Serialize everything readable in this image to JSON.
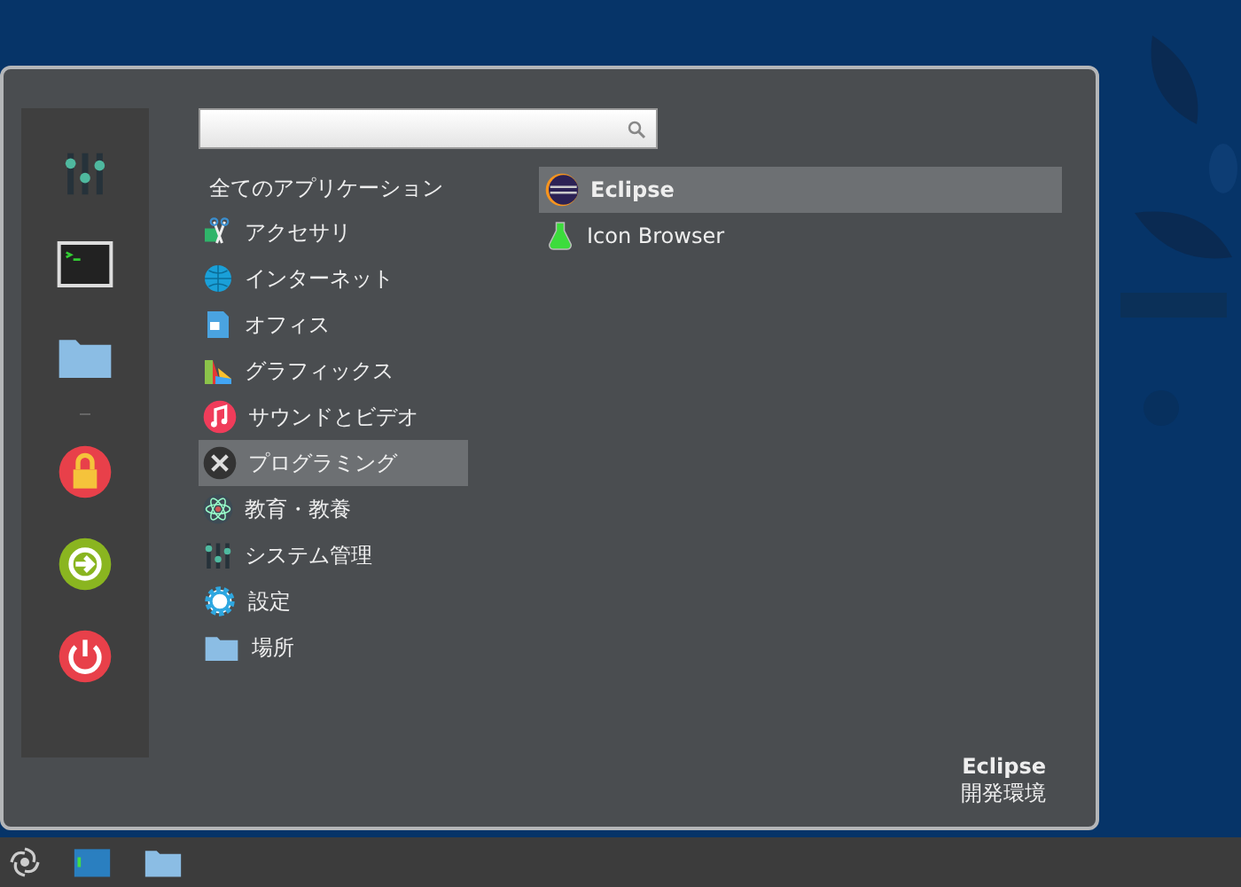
{
  "categories": [
    {
      "label": "全てのアプリケーション",
      "selected": false
    },
    {
      "label": "アクセサリ",
      "selected": false
    },
    {
      "label": "インターネット",
      "selected": false
    },
    {
      "label": "オフィス",
      "selected": false
    },
    {
      "label": "グラフィックス",
      "selected": false
    },
    {
      "label": "サウンドとビデオ",
      "selected": false
    },
    {
      "label": "プログラミング",
      "selected": true
    },
    {
      "label": "教育・教養",
      "selected": false
    },
    {
      "label": "システム管理",
      "selected": false
    },
    {
      "label": "設定",
      "selected": false
    },
    {
      "label": "場所",
      "selected": false
    }
  ],
  "apps": [
    {
      "label": "Eclipse",
      "selected": true
    },
    {
      "label": "Icon Browser",
      "selected": false
    }
  ],
  "description": {
    "title": "Eclipse",
    "subtitle": "開発環境"
  }
}
